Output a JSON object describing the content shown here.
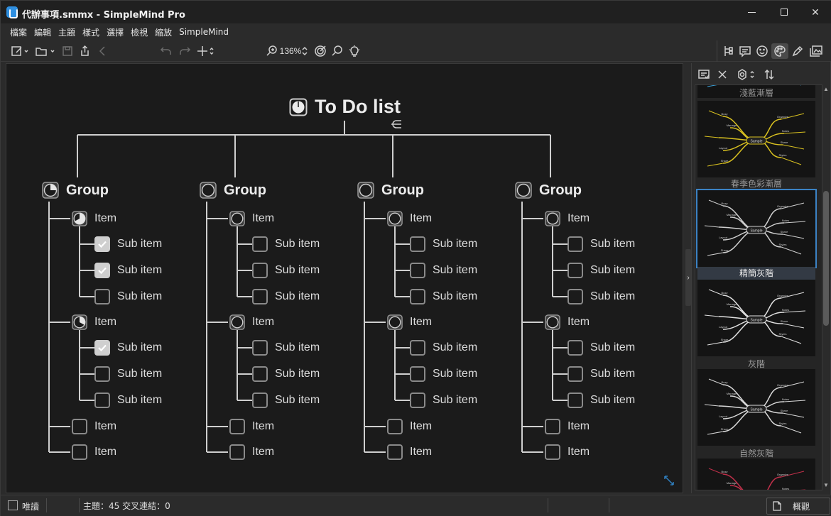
{
  "window": {
    "title": "代辦事項.smmx - SimpleMind Pro"
  },
  "menu": [
    "檔案",
    "編輯",
    "主題",
    "樣式",
    "選擇",
    "檢視",
    "縮放",
    "SimpleMind"
  ],
  "toolbar": {
    "zoom": "136%"
  },
  "mindmap": {
    "root": "To Do list",
    "groups": [
      {
        "label": "Group",
        "progress": 0.25,
        "items": [
          {
            "label": "Item",
            "progress": 0.67,
            "subs": [
              {
                "label": "Sub item",
                "checked": true
              },
              {
                "label": "Sub item",
                "checked": true
              },
              {
                "label": "Sub item",
                "checked": false
              }
            ]
          },
          {
            "label": "Item",
            "progress": 0.33,
            "subs": [
              {
                "label": "Sub item",
                "checked": true
              },
              {
                "label": "Sub item",
                "checked": false
              },
              {
                "label": "Sub item",
                "checked": false
              }
            ]
          },
          {
            "label": "Item",
            "checkbox": true,
            "subs": []
          },
          {
            "label": "Item",
            "checkbox": true,
            "subs": []
          }
        ]
      },
      {
        "label": "Group",
        "progress": 0,
        "items": [
          {
            "label": "Item",
            "progress": 0,
            "subs": [
              {
                "label": "Sub item",
                "checked": false
              },
              {
                "label": "Sub item",
                "checked": false
              },
              {
                "label": "Sub item",
                "checked": false
              }
            ]
          },
          {
            "label": "Item",
            "progress": 0,
            "subs": [
              {
                "label": "Sub item",
                "checked": false
              },
              {
                "label": "Sub item",
                "checked": false
              },
              {
                "label": "Sub item",
                "checked": false
              }
            ]
          },
          {
            "label": "Item",
            "checkbox": true,
            "subs": []
          },
          {
            "label": "Item",
            "checkbox": true,
            "subs": []
          }
        ]
      },
      {
        "label": "Group",
        "progress": 0,
        "items": [
          {
            "label": "Item",
            "progress": 0,
            "subs": [
              {
                "label": "Sub item",
                "checked": false
              },
              {
                "label": "Sub item",
                "checked": false
              },
              {
                "label": "Sub item",
                "checked": false
              }
            ]
          },
          {
            "label": "Item",
            "progress": 0,
            "subs": [
              {
                "label": "Sub item",
                "checked": false
              },
              {
                "label": "Sub item",
                "checked": false
              },
              {
                "label": "Sub item",
                "checked": false
              }
            ]
          },
          {
            "label": "Item",
            "checkbox": true,
            "subs": []
          },
          {
            "label": "Item",
            "checkbox": true,
            "subs": []
          }
        ]
      },
      {
        "label": "Group",
        "progress": 0,
        "items": [
          {
            "label": "Item",
            "progress": 0,
            "subs": [
              {
                "label": "Sub item",
                "checked": false
              },
              {
                "label": "Sub item",
                "checked": false
              },
              {
                "label": "Sub item",
                "checked": false
              }
            ]
          },
          {
            "label": "Item",
            "progress": 0,
            "subs": [
              {
                "label": "Sub item",
                "checked": false
              },
              {
                "label": "Sub item",
                "checked": false
              },
              {
                "label": "Sub item",
                "checked": false
              }
            ]
          },
          {
            "label": "Item",
            "checkbox": true,
            "subs": []
          },
          {
            "label": "Item",
            "checkbox": true,
            "subs": []
          }
        ]
      }
    ]
  },
  "style_panel": {
    "styles": [
      {
        "label": "淺藍漸層",
        "selected": false,
        "accent": "#3aa0d8"
      },
      {
        "label": "春季色彩漸層",
        "selected": false,
        "accent": "#d8c020"
      },
      {
        "label": "精簡灰階",
        "selected": true,
        "accent": "#cfcfcf"
      },
      {
        "label": "灰階",
        "selected": false,
        "accent": "#e0e0e0"
      },
      {
        "label": "自然灰階",
        "selected": false,
        "accent": "#d8d8d8"
      }
    ],
    "thumb_words": [
      "Sample",
      "Busy",
      "Manage",
      "Layout",
      "Share",
      "Organize",
      "Notes",
      "Share",
      "Styles",
      "Learn more"
    ]
  },
  "statusbar": {
    "readonly": "唯讀",
    "topics": "主題：45 交叉連結：0",
    "overview": "概觀"
  },
  "colors": {
    "selection": "#3b82c4",
    "canvas": "#1b1b1b",
    "lines": "#cfcfcf"
  }
}
